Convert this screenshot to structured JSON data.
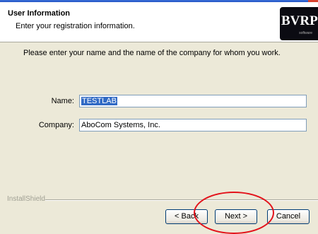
{
  "header": {
    "title": "User Information",
    "subtitle": "Enter your registration information.",
    "logo_text": "BVRP",
    "logo_tagline": "software"
  },
  "content": {
    "instruction": "Please enter your name and the name of the company for whom you work.",
    "name_label": "Name:",
    "name_value": "TESTLAB",
    "company_label": "Company:",
    "company_value": "AboCom Systems, Inc."
  },
  "footer": {
    "installshield_label": "InstallShield",
    "back_label": "< Back",
    "next_label": "Next >",
    "cancel_label": "Cancel"
  },
  "colors": {
    "background": "#ece9d8",
    "selection": "#316ac5",
    "annotation": "#e3131b"
  }
}
